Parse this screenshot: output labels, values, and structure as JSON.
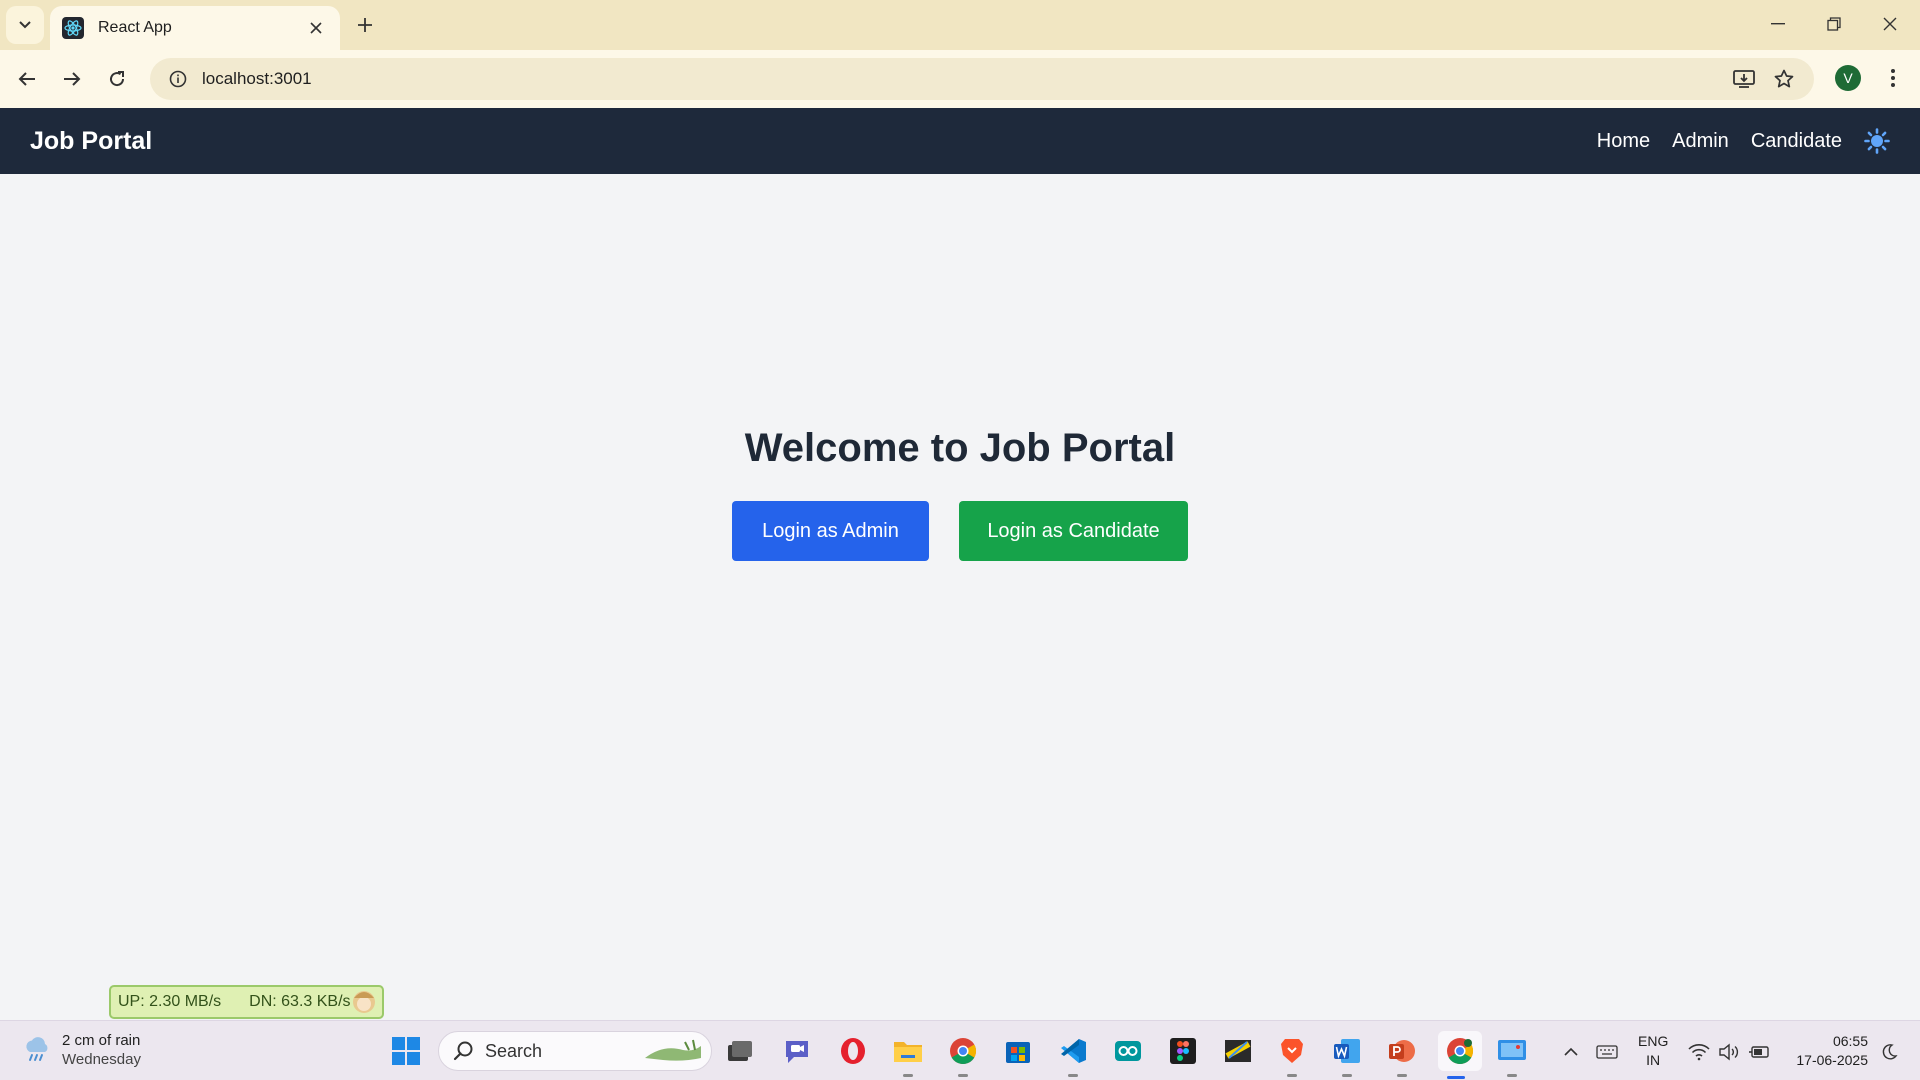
{
  "browser": {
    "tab_title": "React App",
    "url": "localhost:3001",
    "profile_initial": "V"
  },
  "app": {
    "brand": "Job Portal",
    "nav": {
      "home": "Home",
      "admin": "Admin",
      "candidate": "Candidate"
    },
    "colors": {
      "navbar": "#1e293b",
      "admin_button": "#2563eb",
      "candidate_button": "#16a34a",
      "theme_icon": "#60a5fa"
    }
  },
  "main": {
    "title": "Welcome to Job Portal",
    "admin_button": "Login as Admin",
    "candidate_button": "Login as Candidate"
  },
  "netmeter": {
    "up": "UP: 2.30 MB/s",
    "down": "DN: 63.3 KB/s"
  },
  "taskbar": {
    "weather_main": "2 cm of rain",
    "weather_sub": "Wednesday",
    "search_placeholder": "Search",
    "lang_top": "ENG",
    "lang_bottom": "IN",
    "time": "06:55",
    "date": "17-06-2025",
    "apps": [
      "start-icon",
      "task-view-icon",
      "meet-icon",
      "opera-icon",
      "file-explorer-icon",
      "chrome-icon",
      "store-icon",
      "vscode-icon",
      "arduino-icon",
      "figma-icon",
      "app-icon",
      "brave-icon",
      "word-icon",
      "powerpoint-icon",
      "chrome-profile-icon",
      "screen-recorder-icon"
    ]
  }
}
